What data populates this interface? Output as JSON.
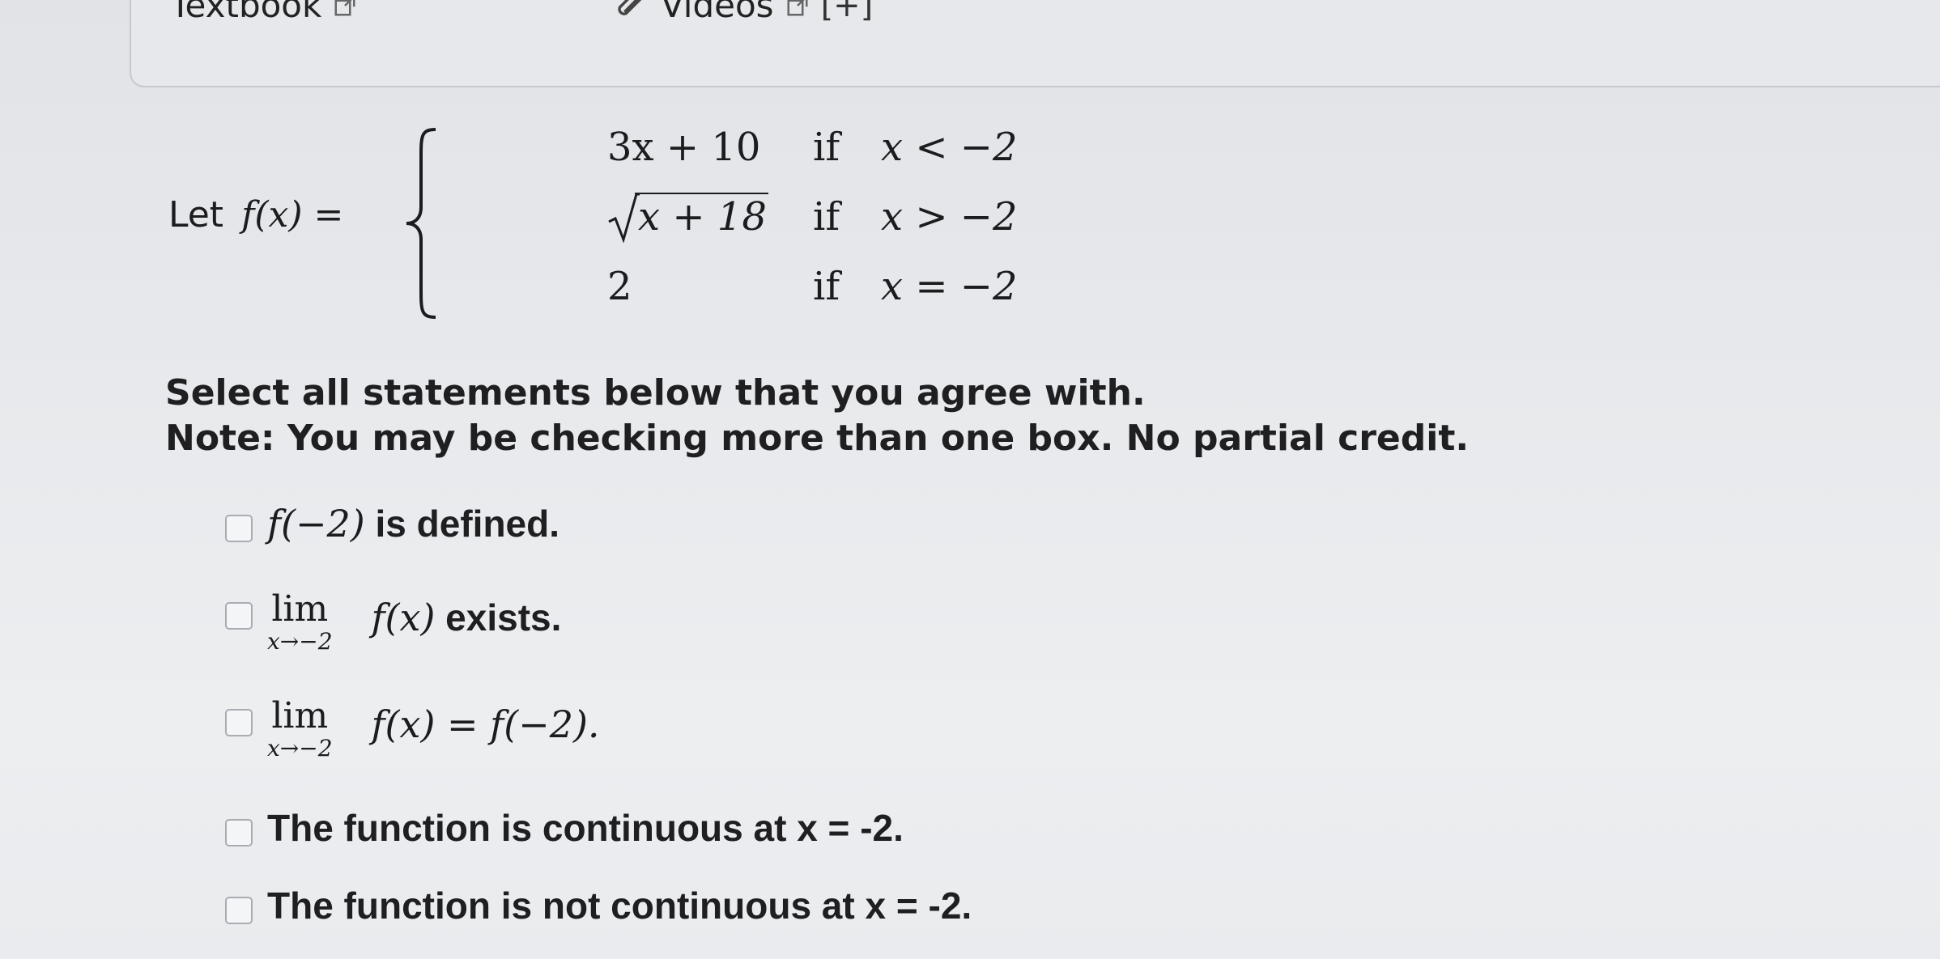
{
  "header": {
    "textbook_label": "Textbook",
    "videos_label": "Videos",
    "expand_label": "[+]"
  },
  "problem": {
    "let_prefix": "Let",
    "function_lhs": "f(x) =",
    "cases": [
      {
        "expr": "3x + 10",
        "if": "if",
        "cond": "x < −2"
      },
      {
        "expr": "x + 18",
        "if": "if",
        "cond": "x > −2"
      },
      {
        "expr": "2",
        "if": "if",
        "cond": "x = −2"
      }
    ],
    "instruction_line1": "Select all statements below that you agree with.",
    "instruction_line2": "Note: You may be checking more than one box. No partial credit."
  },
  "options": {
    "opt1": {
      "math": "f(−2)",
      "text": " is defined.",
      "checked": false
    },
    "opt2": {
      "lim": "lim",
      "sub": "x→−2",
      "math": "f(x)",
      "text": " exists.",
      "checked": false
    },
    "opt3": {
      "lim": "lim",
      "sub": "x→−2",
      "math": "f(x) = f(−2).",
      "checked": false
    },
    "opt4": {
      "text": "The function is continuous at x = -2.",
      "checked": false
    },
    "opt5": {
      "text": "The function is not continuous at x = -2.",
      "checked": false
    }
  }
}
